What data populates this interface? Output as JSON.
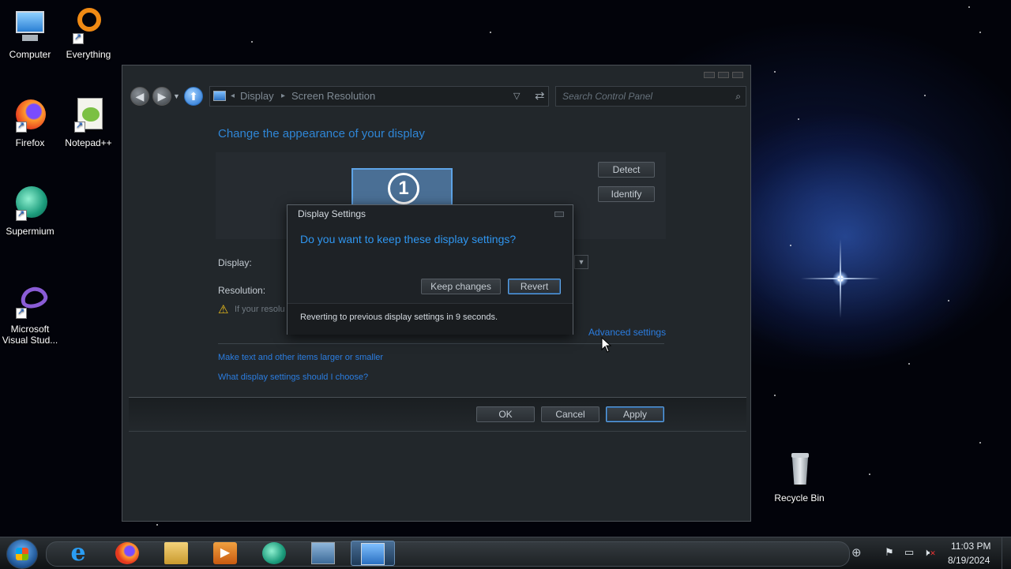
{
  "desktop": {
    "icons": [
      {
        "label": "Computer"
      },
      {
        "label": "Everything"
      },
      {
        "label": "Firefox"
      },
      {
        "label": "Notepad++"
      },
      {
        "label": "Supermium"
      },
      {
        "label": "Microsoft Visual Stud..."
      },
      {
        "label": "Recycle Bin"
      }
    ]
  },
  "window": {
    "breadcrumb": [
      "Display",
      "Screen Resolution"
    ],
    "search_placeholder": "Search Control Panel",
    "heading": "Change the appearance of your display",
    "monitor_number": "1",
    "detect_label": "Detect",
    "identify_label": "Identify",
    "display_label": "Display:",
    "resolution_label": "Resolution:",
    "warning_text": "If your resolu",
    "advanced_settings": "Advanced settings",
    "link_text_size": "Make text and other items larger or smaller",
    "link_what_settings": "What display settings should I choose?",
    "ok_label": "OK",
    "cancel_label": "Cancel",
    "apply_label": "Apply"
  },
  "dialog": {
    "title": "Display Settings",
    "question": "Do you want to keep these display settings?",
    "keep_label": "Keep changes",
    "revert_label": "Revert",
    "countdown": "Reverting to previous display settings in 9 seconds."
  },
  "taskbar": {
    "time": "11:03 PM",
    "date": "8/19/2024"
  },
  "colors": {
    "link": "#2b7de0",
    "heading": "#2f86d6",
    "dialog_question": "#2f96f0"
  }
}
